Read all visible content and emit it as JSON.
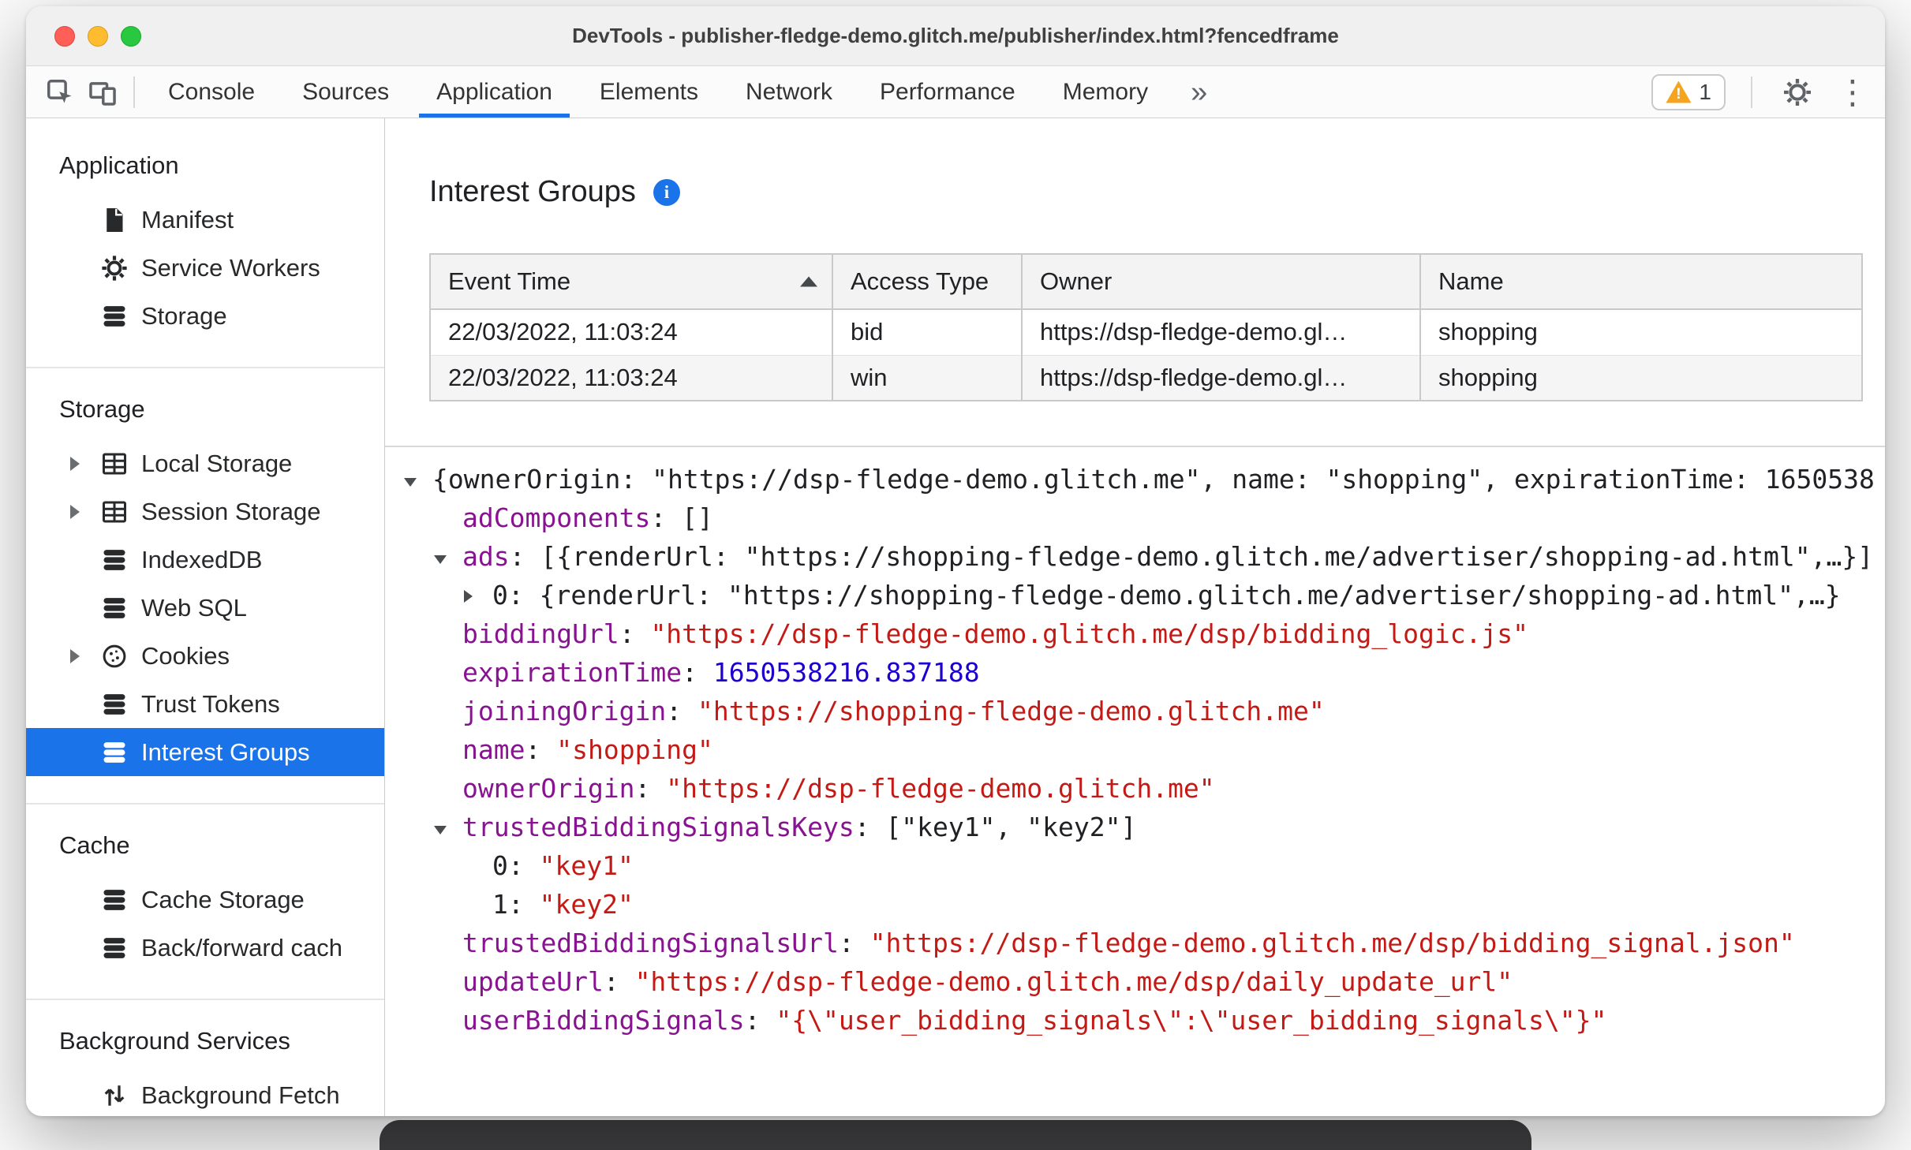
{
  "colors": {
    "accent_blue": "#1a73e8",
    "selected_item_bg": "#1a73e8",
    "json_key_purple": "#881391",
    "json_string_red": "#c41a16",
    "json_number_blue": "#1c00cf",
    "warning_orange": "#f5a41c"
  },
  "window": {
    "title": "DevTools - publisher-fledge-demo.glitch.me/publisher/index.html?fencedframe",
    "traffic_lights": [
      "close",
      "minimize",
      "zoom"
    ]
  },
  "toolbar": {
    "left_icons": [
      "inspect-cursor-icon",
      "device-toolbar-icon"
    ],
    "tabs": [
      {
        "label": "Console",
        "active": false
      },
      {
        "label": "Sources",
        "active": false
      },
      {
        "label": "Application",
        "active": true
      },
      {
        "label": "Elements",
        "active": false
      },
      {
        "label": "Network",
        "active": false
      },
      {
        "label": "Performance",
        "active": false
      },
      {
        "label": "Memory",
        "active": false
      }
    ],
    "more_tabs_label": "»",
    "warning_badge": {
      "icon": "warning-triangle-icon",
      "count": "1"
    },
    "right_icons": [
      "settings-gear-icon",
      "more-options-kebab-icon"
    ]
  },
  "sidebar": {
    "sections": [
      {
        "title": "Application",
        "items": [
          {
            "label": "Manifest",
            "icon": "document-icon"
          },
          {
            "label": "Service Workers",
            "icon": "gear-icon"
          },
          {
            "label": "Storage",
            "icon": "database-icon"
          }
        ]
      },
      {
        "title": "Storage",
        "items": [
          {
            "label": "Local Storage",
            "icon": "table-icon",
            "expandable": true
          },
          {
            "label": "Session Storage",
            "icon": "table-icon",
            "expandable": true
          },
          {
            "label": "IndexedDB",
            "icon": "database-icon"
          },
          {
            "label": "Web SQL",
            "icon": "database-icon"
          },
          {
            "label": "Cookies",
            "icon": "cookie-icon",
            "expandable": true
          },
          {
            "label": "Trust Tokens",
            "icon": "database-icon"
          },
          {
            "label": "Interest Groups",
            "icon": "database-icon",
            "selected": true
          }
        ]
      },
      {
        "title": "Cache",
        "items": [
          {
            "label": "Cache Storage",
            "icon": "database-icon"
          },
          {
            "label": "Back/forward cach",
            "icon": "database-icon"
          }
        ]
      },
      {
        "title": "Background Services",
        "items": [
          {
            "label": "Background Fetch",
            "icon": "fetch-icon"
          }
        ]
      }
    ]
  },
  "main": {
    "title": "Interest Groups",
    "info_icon": "info-icon",
    "table": {
      "columns": [
        "Event Time",
        "Access Type",
        "Owner",
        "Name"
      ],
      "sort": {
        "column": "Event Time",
        "direction": "ascending"
      },
      "rows": [
        [
          "22/03/2022, 11:03:24",
          "bid",
          "https://dsp-fledge-demo.gl…",
          "shopping"
        ],
        [
          "22/03/2022, 11:03:24",
          "win",
          "https://dsp-fledge-demo.gl…",
          "shopping"
        ]
      ]
    },
    "tree": [
      {
        "indent": 0,
        "arrow": "expanded",
        "segments": [
          {
            "t": "plain",
            "text": "{ownerOrigin: \"https://dsp-fledge-demo.glitch.me\", name: \"shopping\", expirationTime: 1650538"
          }
        ]
      },
      {
        "indent": 1,
        "arrow": null,
        "segments": [
          {
            "t": "name",
            "text": "adComponents"
          },
          {
            "t": "plain",
            "text": ": []"
          }
        ]
      },
      {
        "indent": 1,
        "arrow": "expanded",
        "segments": [
          {
            "t": "name",
            "text": "ads"
          },
          {
            "t": "plain",
            "text": ": [{renderUrl: \"https://shopping-fledge-demo.glitch.me/advertiser/shopping-ad.html\",…}]"
          }
        ]
      },
      {
        "indent": 2,
        "arrow": "collapsed",
        "segments": [
          {
            "t": "plain",
            "text": "0: {renderUrl: \"https://shopping-fledge-demo.glitch.me/advertiser/shopping-ad.html\",…}"
          }
        ]
      },
      {
        "indent": 1,
        "arrow": null,
        "segments": [
          {
            "t": "name",
            "text": "biddingUrl"
          },
          {
            "t": "plain",
            "text": ": "
          },
          {
            "t": "string",
            "text": "\"https://dsp-fledge-demo.glitch.me/dsp/bidding_logic.js\""
          }
        ]
      },
      {
        "indent": 1,
        "arrow": null,
        "segments": [
          {
            "t": "name",
            "text": "expirationTime"
          },
          {
            "t": "plain",
            "text": ": "
          },
          {
            "t": "number",
            "text": "1650538216.837188"
          }
        ]
      },
      {
        "indent": 1,
        "arrow": null,
        "segments": [
          {
            "t": "name",
            "text": "joiningOrigin"
          },
          {
            "t": "plain",
            "text": ": "
          },
          {
            "t": "string",
            "text": "\"https://shopping-fledge-demo.glitch.me\""
          }
        ]
      },
      {
        "indent": 1,
        "arrow": null,
        "segments": [
          {
            "t": "name",
            "text": "name"
          },
          {
            "t": "plain",
            "text": ": "
          },
          {
            "t": "string",
            "text": "\"shopping\""
          }
        ]
      },
      {
        "indent": 1,
        "arrow": null,
        "segments": [
          {
            "t": "name",
            "text": "ownerOrigin"
          },
          {
            "t": "plain",
            "text": ": "
          },
          {
            "t": "string",
            "text": "\"https://dsp-fledge-demo.glitch.me\""
          }
        ]
      },
      {
        "indent": 1,
        "arrow": "expanded",
        "segments": [
          {
            "t": "name",
            "text": "trustedBiddingSignalsKeys"
          },
          {
            "t": "plain",
            "text": ": [\"key1\", \"key2\"]"
          }
        ]
      },
      {
        "indent": 2,
        "arrow": null,
        "segments": [
          {
            "t": "plain",
            "text": "0: "
          },
          {
            "t": "string",
            "text": "\"key1\""
          }
        ]
      },
      {
        "indent": 2,
        "arrow": null,
        "segments": [
          {
            "t": "plain",
            "text": "1: "
          },
          {
            "t": "string",
            "text": "\"key2\""
          }
        ]
      },
      {
        "indent": 1,
        "arrow": null,
        "segments": [
          {
            "t": "name",
            "text": "trustedBiddingSignalsUrl"
          },
          {
            "t": "plain",
            "text": ": "
          },
          {
            "t": "string",
            "text": "\"https://dsp-fledge-demo.glitch.me/dsp/bidding_signal.json\""
          }
        ]
      },
      {
        "indent": 1,
        "arrow": null,
        "segments": [
          {
            "t": "name",
            "text": "updateUrl"
          },
          {
            "t": "plain",
            "text": ": "
          },
          {
            "t": "string",
            "text": "\"https://dsp-fledge-demo.glitch.me/dsp/daily_update_url\""
          }
        ]
      },
      {
        "indent": 1,
        "arrow": null,
        "segments": [
          {
            "t": "name",
            "text": "userBiddingSignals"
          },
          {
            "t": "plain",
            "text": ": "
          },
          {
            "t": "string",
            "text": "\"{\\\"user_bidding_signals\\\":\\\"user_bidding_signals\\\"}\""
          }
        ]
      }
    ]
  }
}
